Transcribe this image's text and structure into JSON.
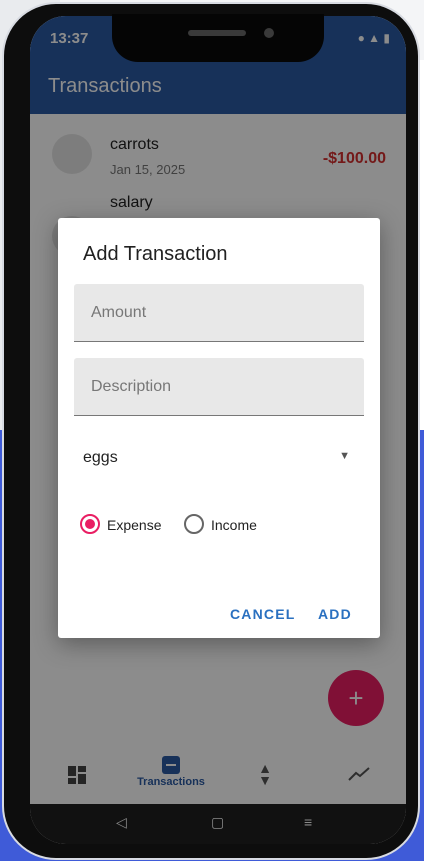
{
  "status_bar": {
    "time": "13:37"
  },
  "app_bar": {
    "title": "Transactions"
  },
  "transactions": [
    {
      "title": "carrots",
      "date": "Jan 15, 2025",
      "amount": "-$100.00",
      "type": "expense"
    },
    {
      "title": "salary",
      "date": "",
      "amount": "",
      "type": "income"
    }
  ],
  "dialog": {
    "title": "Add Transaction",
    "amount_placeholder": "Amount",
    "description_placeholder": "Description",
    "category_selected": "eggs",
    "type_options": [
      {
        "label": "Expense",
        "checked": true
      },
      {
        "label": "Income",
        "checked": false
      }
    ],
    "cancel_label": "CANCEL",
    "add_label": "ADD"
  },
  "fab": {
    "icon": "+"
  },
  "bottom_nav": {
    "items": [
      {
        "icon": "dashboard-icon",
        "label": ""
      },
      {
        "icon": "transactions-icon",
        "label": "Transactions",
        "active": true
      },
      {
        "icon": "sort-icon",
        "label": ""
      },
      {
        "icon": "trend-icon",
        "label": ""
      }
    ]
  },
  "colors": {
    "primary": "#2a5aa3",
    "accent": "#e91e63",
    "expense": "#d32f2f",
    "income": "#2e9e3a",
    "button_text": "#2a70c0"
  }
}
